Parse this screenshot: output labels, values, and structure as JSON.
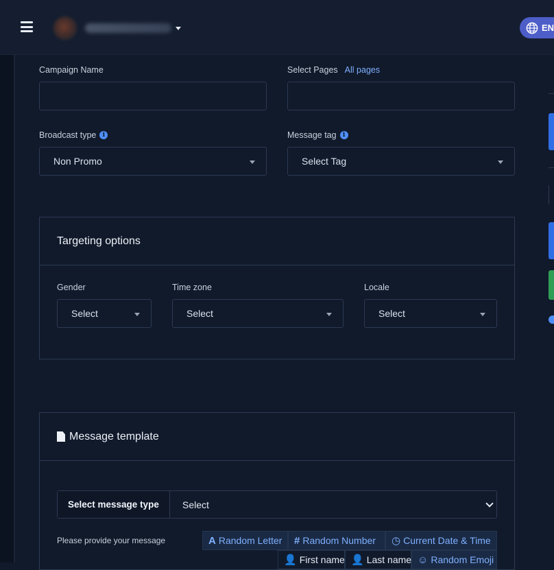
{
  "header": {
    "language": "EN"
  },
  "form": {
    "campaign_name_label": "Campaign Name",
    "campaign_name_value": "",
    "select_pages_label": "Select Pages",
    "all_pages_link": "All pages",
    "select_pages_value": "",
    "broadcast_type_label": "Broadcast type",
    "broadcast_type_value": "Non Promo",
    "message_tag_label": "Message tag",
    "message_tag_value": "Select Tag"
  },
  "targeting": {
    "title": "Targeting options",
    "gender_label": "Gender",
    "gender_value": "Select",
    "timezone_label": "Time zone",
    "timezone_value": "Select",
    "locale_label": "Locale",
    "locale_value": "Select"
  },
  "template": {
    "title": "Message template",
    "message_type_label": "Select message type",
    "message_type_value": "Select",
    "provide_message_label": "Please provide your message",
    "buttons": {
      "random_letter": "Random Letter",
      "random_number": "Random Number",
      "current_datetime": "Current Date & Time",
      "first_name": "First name",
      "last_name": "Last name",
      "random_emoji": "Random Emoji"
    }
  },
  "colors": {
    "background": "#111a2b",
    "accent": "#4e5ec9",
    "link": "#7fb0ff",
    "green": "#2f9e55",
    "blue": "#2f6fe4"
  }
}
